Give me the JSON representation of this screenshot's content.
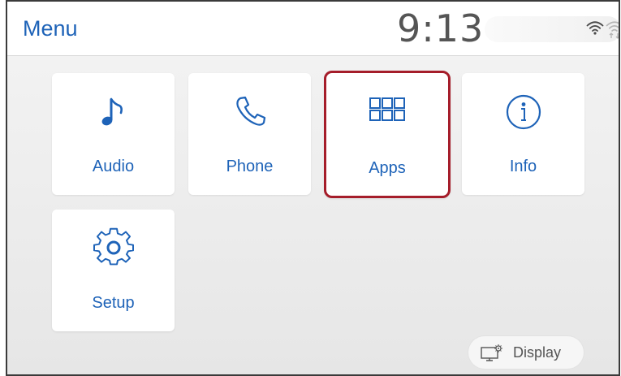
{
  "header": {
    "title": "Menu",
    "time": "9:13"
  },
  "status": {
    "wifi_icon": "wifi-icon",
    "wifi_data_icon": "wifi-data-transfer-icon"
  },
  "menu_tiles": [
    {
      "label": "Audio",
      "icon": "music-note-icon",
      "selected": false
    },
    {
      "label": "Phone",
      "icon": "phone-icon",
      "selected": false
    },
    {
      "label": "Apps",
      "icon": "apps-grid-icon",
      "selected": true
    },
    {
      "label": "Info",
      "icon": "info-icon",
      "selected": false
    },
    {
      "label": "Setup",
      "icon": "gear-icon",
      "selected": false
    }
  ],
  "footer": {
    "display_label": "Display",
    "display_icon": "display-settings-icon"
  },
  "colors": {
    "accent": "#1e63b8",
    "selection_border": "#a51d2a",
    "clock_text": "#555555"
  }
}
